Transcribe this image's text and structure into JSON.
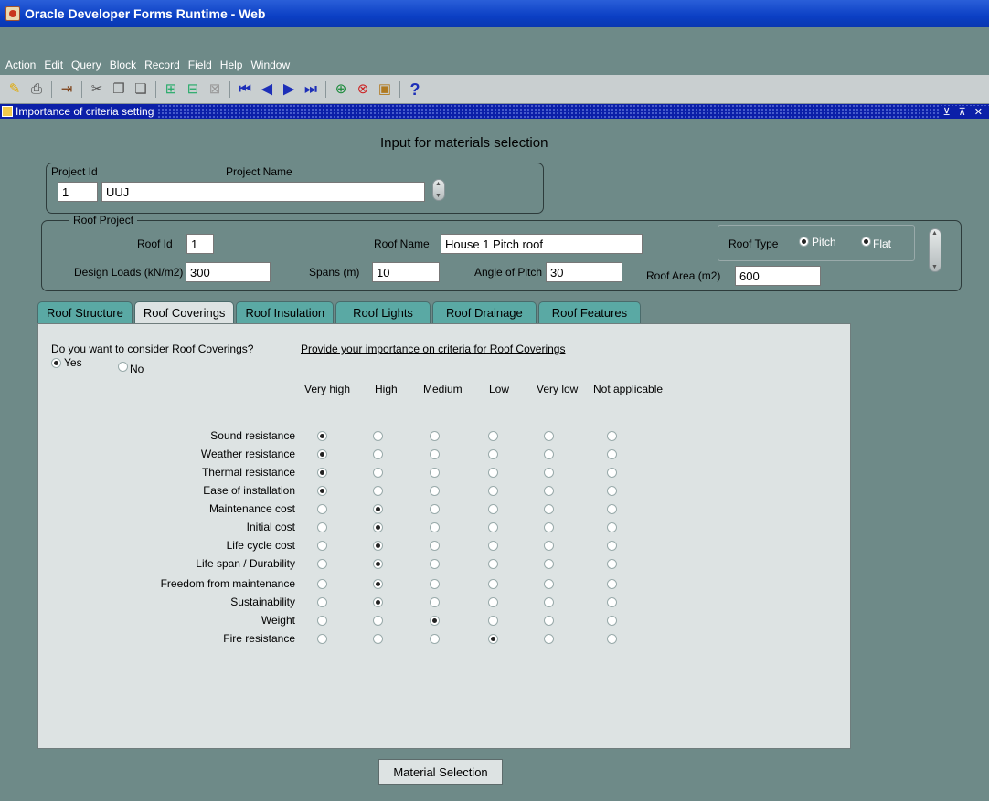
{
  "window": {
    "title": "Oracle Developer Forms Runtime - Web"
  },
  "menu": [
    "Action",
    "Edit",
    "Query",
    "Block",
    "Record",
    "Field",
    "Help",
    "Window"
  ],
  "subwindow": {
    "title": "Importance of criteria setting"
  },
  "form": {
    "heading": "Input for materials selection",
    "project": {
      "id_label": "Project Id",
      "name_label": "Project Name",
      "id": "1",
      "name": "UUJ"
    },
    "roof": {
      "group_label": "Roof Project",
      "roof_id_label": "Roof Id",
      "roof_id": "1",
      "roof_name_label": "Roof Name",
      "roof_name": "House 1 Pitch roof",
      "roof_type_label": "Roof Type",
      "pitch_label": "Pitch",
      "flat_label": "Flat",
      "roof_type_selected": "Pitch",
      "design_loads_label": "Design Loads (kN/m2)",
      "design_loads": "300",
      "spans_label": "Spans (m)",
      "spans": "10",
      "angle_label": "Angle of Pitch",
      "angle": "30",
      "area_label": "Roof Area (m2)",
      "area": "600"
    }
  },
  "tabs": [
    {
      "label": "Roof Structure",
      "active": false
    },
    {
      "label": "Roof Coverings",
      "active": true
    },
    {
      "label": "Roof Insulation",
      "active": false
    },
    {
      "label": "Roof Lights",
      "active": false
    },
    {
      "label": "Roof Drainage",
      "active": false
    },
    {
      "label": "Roof Features",
      "active": false
    }
  ],
  "panel": {
    "question": "Do you want to consider Roof Coverings?",
    "yes_label": "Yes",
    "no_label": "No",
    "consider": "Yes",
    "instruction": "Provide your importance on criteria for Roof Coverings",
    "levels": [
      "Very high",
      "High",
      "Medium",
      "Low",
      "Very low",
      "Not applicable"
    ],
    "criteria": [
      {
        "name": "Sound resistance",
        "selected": "Very high"
      },
      {
        "name": "Weather resistance",
        "selected": "Very high"
      },
      {
        "name": "Thermal resistance",
        "selected": "Very high"
      },
      {
        "name": "Ease of installation",
        "selected": "Very high"
      },
      {
        "name": "Maintenance cost",
        "selected": "High"
      },
      {
        "name": "Initial cost",
        "selected": "High"
      },
      {
        "name": "Life cycle cost",
        "selected": "High"
      },
      {
        "name": "Life span / Durability",
        "selected": "High"
      },
      {
        "name": "Freedom from maintenance",
        "selected": "High"
      },
      {
        "name": "Sustainability",
        "selected": "High"
      },
      {
        "name": "Weight",
        "selected": "Medium"
      },
      {
        "name": "Fire resistance",
        "selected": "Low"
      }
    ]
  },
  "buttons": {
    "material_selection": "Material Selection"
  }
}
